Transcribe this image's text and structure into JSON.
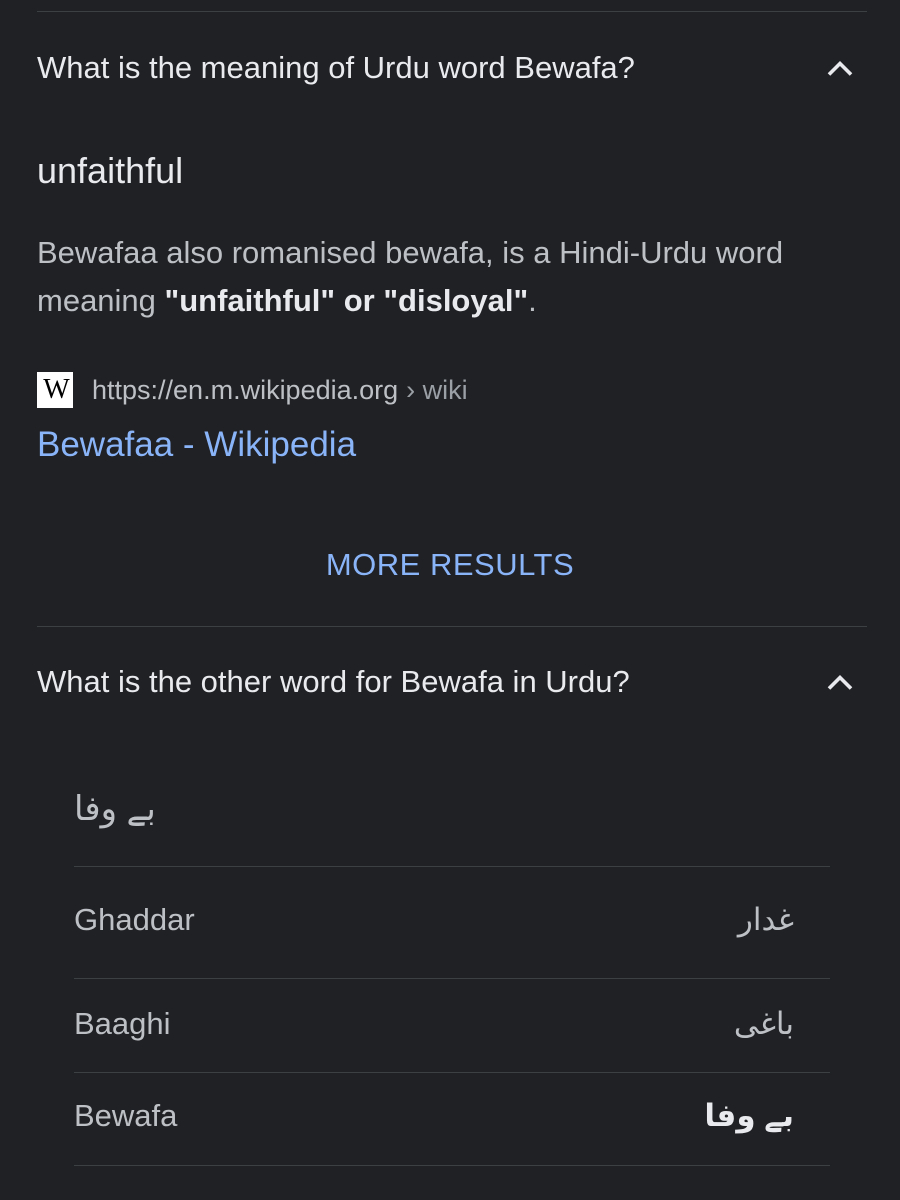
{
  "faq": [
    {
      "question": "What is the meaning of Urdu word Bewafa?",
      "expanded": true,
      "answer": {
        "title": "unfaithful",
        "body_prefix": "Bewafaa also romanised bewafa, is a Hindi-Urdu word meaning ",
        "body_bold": "\"unfaithful\" or \"disloyal\"",
        "body_suffix": "."
      },
      "source": {
        "favicon_letter": "W",
        "url": "https://en.m.wikipedia.org",
        "crumb": "› wiki",
        "title": "Bewafaa - Wikipedia"
      }
    },
    {
      "question": "What is the other word for Bewafa in Urdu?",
      "expanded": true,
      "table_header": "بے وفا",
      "rows": [
        {
          "roman": "Ghaddar",
          "urdu": "غدار",
          "bold": false
        },
        {
          "roman": "Baaghi",
          "urdu": "باغی",
          "bold": false
        },
        {
          "roman": "Bewafa",
          "urdu": "بے وفا",
          "bold": true
        }
      ]
    }
  ],
  "more_results_label": "MORE RESULTS",
  "icons": {
    "collapse": "chevron-up-icon",
    "favicon": "wikipedia-icon"
  },
  "colors": {
    "background": "#202124",
    "primary_text": "#e8eaed",
    "secondary_text": "#bdc1c6",
    "link": "#8ab4f8",
    "divider": "#3c4043"
  }
}
